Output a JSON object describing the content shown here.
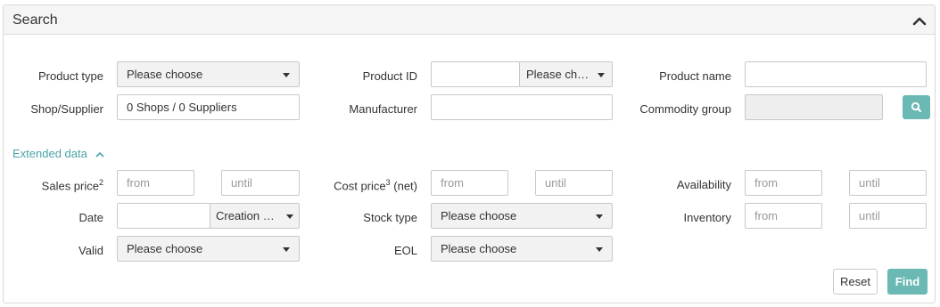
{
  "panel": {
    "title": "Search"
  },
  "row1": {
    "product_type_label": "Product type",
    "product_type_value": "Please choose",
    "product_id_label": "Product ID",
    "product_id_value": "",
    "product_id_select": "Please choose",
    "product_name_label": "Product name",
    "product_name_value": ""
  },
  "row2": {
    "shop_supplier_label": "Shop/Supplier",
    "shop_supplier_value": "0 Shops / 0 Suppliers",
    "manufacturer_label": "Manufacturer",
    "manufacturer_value": "",
    "commodity_group_label": "Commodity group",
    "commodity_group_value": ""
  },
  "extended": {
    "toggle_label": "Extended data"
  },
  "row3": {
    "sales_price_label": "Sales price²",
    "cost_price_label": "Cost price³ (net)",
    "availability_label": "Availability",
    "from_placeholder": "from",
    "until_placeholder": "until"
  },
  "row4": {
    "date_label": "Date",
    "date_value": "",
    "date_type_select": "Creation date",
    "stock_type_label": "Stock type",
    "stock_type_value": "Please choose",
    "inventory_label": "Inventory"
  },
  "row5": {
    "valid_label": "Valid",
    "valid_value": "Please choose",
    "eol_label": "EOL",
    "eol_value": "Please choose"
  },
  "buttons": {
    "reset": "Reset",
    "find": "Find"
  },
  "colors": {
    "accent": "#6bb9b4",
    "link": "#4aa3a8"
  },
  "icons": {
    "collapse": "chevron-up-icon",
    "search": "search-icon",
    "caret": "caret-down-icon"
  }
}
